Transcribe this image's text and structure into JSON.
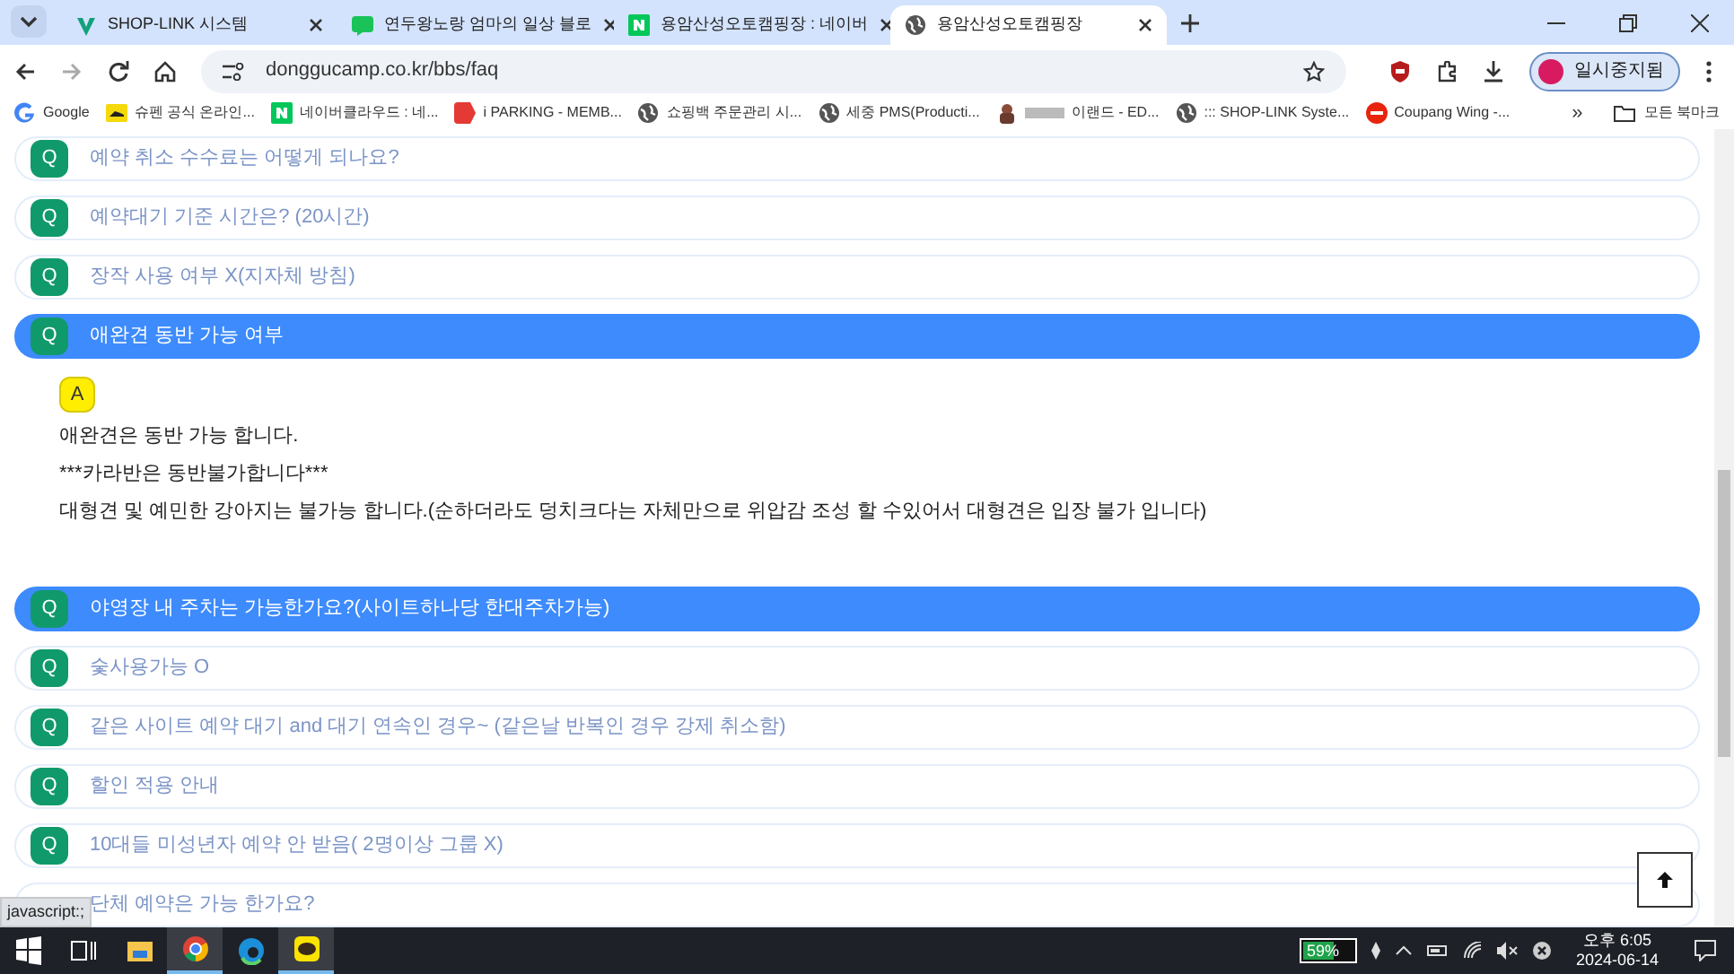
{
  "browser": {
    "tabs": [
      {
        "title": "SHOP-LINK 시스템",
        "selected": false
      },
      {
        "title": "연두왕노랑 엄마의 일상 블로",
        "selected": false
      },
      {
        "title": "용암산성오토캠핑장 : 네이버",
        "selected": false
      },
      {
        "title": "용암산성오토캠핑장",
        "selected": true
      }
    ],
    "address": "donggucamp.co.kr/bbs/faq",
    "profile": {
      "label": "일시중지됨"
    },
    "bookmarks": [
      {
        "label": "Google"
      },
      {
        "label": "슈펜 공식 온라인..."
      },
      {
        "label": "네이버클라우드 : 네..."
      },
      {
        "label": "i PARKING - MEMB..."
      },
      {
        "label": "쇼핑백 주문관리 시..."
      },
      {
        "label": "세중 PMS(Producti..."
      },
      {
        "label": "이랜드 - ED..."
      },
      {
        "label": "::: SHOP-LINK Syste..."
      },
      {
        "label": "Coupang Wing -..."
      }
    ],
    "overflow": "»",
    "all_bookmarks": "모든 북마크"
  },
  "faq": [
    {
      "badge": "Q",
      "question": "예약 취소 수수료는 어떻게 되나요?",
      "selected": false
    },
    {
      "badge": "Q",
      "question": "예약대기 기준 시간은? (20시간)",
      "selected": false
    },
    {
      "badge": "Q",
      "question": "장작 사용 여부 X(지자체 방침)",
      "selected": false
    },
    {
      "badge": "Q",
      "question": "애완견 동반 가능 여부",
      "selected": true,
      "answer": {
        "badge": "A",
        "lines": [
          "애완견은 동반 가능 합니다.",
          "***카라반은 동반불가합니다***",
          "대형견 및 예민한 강아지는 불가능 합니다.(순하더라도 덩치크다는 자체만으로 위압감 조성 할 수있어서 대형견은 입장 불가 입니다)"
        ]
      }
    },
    {
      "badge": "Q",
      "question": "야영장 내 주차는 가능한가요?(사이트하나당 한대주차가능)",
      "selected": true
    },
    {
      "badge": "Q",
      "question": "숯사용가능 O",
      "selected": false
    },
    {
      "badge": "Q",
      "question": "같은 사이트 예약 대기 and 대기 연속인 경우~ (같은날 반복인 경우 강제 취소함)",
      "selected": false
    },
    {
      "badge": "Q",
      "question": "할인 적용 안내",
      "selected": false
    },
    {
      "badge": "Q",
      "question": "10대들 미성년자 예약 안 받음( 2명이상 그룹 X)",
      "selected": false
    },
    {
      "question": "단체 예약은 가능 한가요?",
      "selected": false
    }
  ],
  "status_link": "javascript:;",
  "taskbar": {
    "battery": "59%",
    "time": "오후 6:05",
    "date": "2024-06-14"
  }
}
